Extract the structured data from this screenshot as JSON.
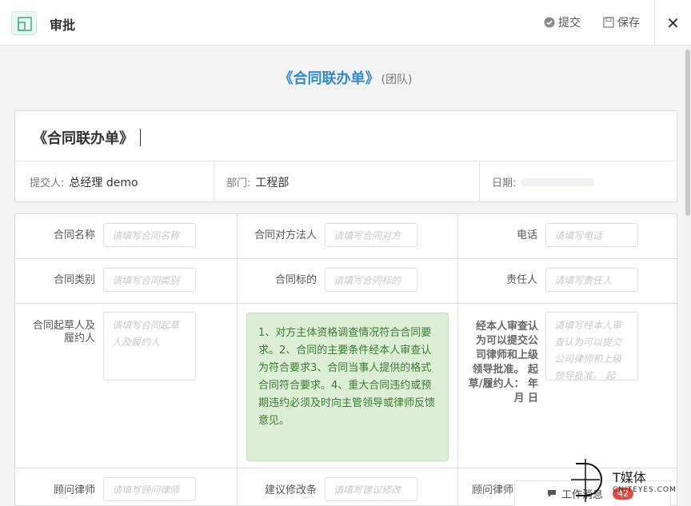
{
  "header": {
    "title": "审批",
    "submit_label": "提交",
    "save_label": "保存",
    "close_symbol": "✕"
  },
  "document": {
    "title": "《合同联办单》",
    "subtitle": "(团队)"
  },
  "form": {
    "title": "《合同联办单》",
    "submitter_label": "提交人:",
    "submitter_value": "总经理 demo",
    "department_label": "部门:",
    "department_value": "工程部",
    "date_label": "日期:",
    "date_value": ""
  },
  "fields": {
    "contract_name": {
      "label": "合同名称",
      "placeholder": "请填写合同名称"
    },
    "counterparty": {
      "label": "合同对方法人",
      "placeholder": "请填写合同对方"
    },
    "phone": {
      "label": "电话",
      "placeholder": "请填写电话"
    },
    "contract_type": {
      "label": "合同类别",
      "placeholder": "请填写合同类别"
    },
    "contract_subject": {
      "label": "合同标的",
      "placeholder": "请填写合同标的"
    },
    "responsible": {
      "label": "责任人",
      "placeholder": "请填写责任人"
    },
    "drafter": {
      "label": "合同起草人及履约人",
      "placeholder": "请填写合同起草人及履约人"
    },
    "handler_review": {
      "label": "经本人审查认为可以提交公司律师和上级领导批准。 起草/履约人： 年 月 日",
      "placeholder": "请填写经本人审查认为可以提交公司律师和上级领导批准。 起"
    },
    "consultant_lawyer_1": {
      "label": "顾问律师",
      "placeholder": "请填写顾问律师"
    },
    "suggestion": {
      "label": "建议修改条",
      "placeholder": "请填写建议修改"
    },
    "consultant_lawyer_2": {
      "label": "顾问律师",
      "placeholder": ""
    }
  },
  "note_text": "1、对方主体资格调查情况符合合同要求。2、合同的主要条件经本人审查认为符合要求3、合同当事人提供的格式合同符合要求。4、重大合同违约或预期违约必须及时向主管领导或律师反馈意见。",
  "message_bar": {
    "label": "工作消息",
    "count": "42"
  },
  "watermark": {
    "brand": "T媒体",
    "site": "CNITEYES.COM"
  },
  "colors": {
    "accent": "#2f8ad2",
    "note_bg": "#dcefd5",
    "note_text": "#3d7a37",
    "badge": "#e64b3c"
  }
}
